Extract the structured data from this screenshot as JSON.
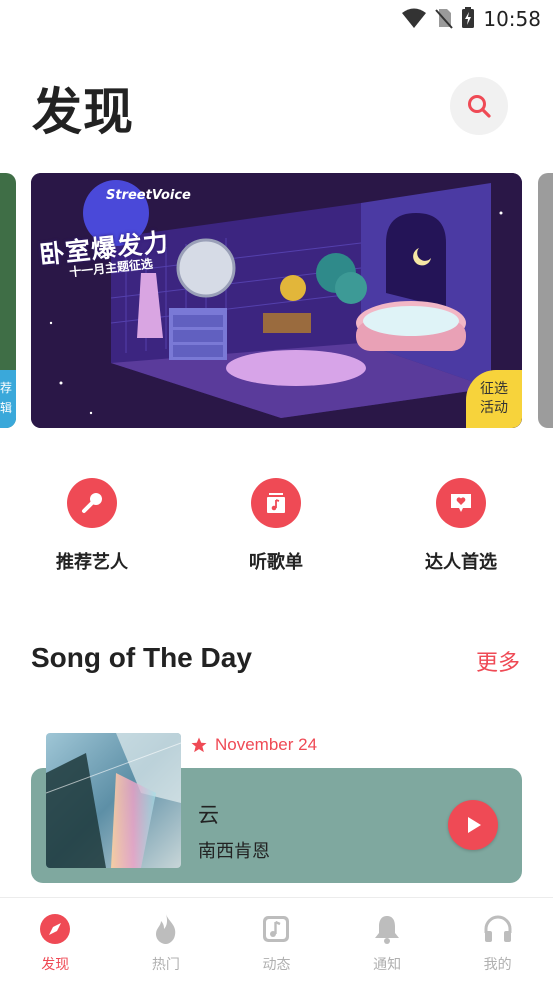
{
  "status_bar": {
    "time": "10:58",
    "icons": [
      "wifi-icon",
      "no-sim-icon",
      "battery-charging-icon"
    ]
  },
  "header": {
    "title": "发现",
    "search_icon": "search-icon"
  },
  "banner": {
    "brand": "StreetVoice",
    "title": "卧室爆发力",
    "subtitle": "十一月主题征选",
    "badge_line1": "征选",
    "badge_line2": "活动",
    "peek_left_line1": "荐",
    "peek_left_line2": "辑"
  },
  "categories": [
    {
      "label": "推荐艺人",
      "icon": "microphone-icon"
    },
    {
      "label": "听歌单",
      "icon": "album-icon"
    },
    {
      "label": "达人首选",
      "icon": "heart-chat-icon"
    }
  ],
  "song_of_the_day": {
    "section_title": "Song of The Day",
    "more_label": "更多",
    "date": "November 24",
    "title": "云",
    "artist": "南西肯恩"
  },
  "bottom_nav": [
    {
      "label": "发现",
      "icon": "compass-icon",
      "active": true
    },
    {
      "label": "热门",
      "icon": "flame-icon",
      "active": false
    },
    {
      "label": "动态",
      "icon": "music-note-icon",
      "active": false
    },
    {
      "label": "通知",
      "icon": "bell-icon",
      "active": false
    },
    {
      "label": "我的",
      "icon": "headphones-icon",
      "active": false
    }
  ],
  "colors": {
    "accent": "#ef4a55",
    "song_card": "#7fa89f",
    "banner_badge": "#f7d33b"
  }
}
